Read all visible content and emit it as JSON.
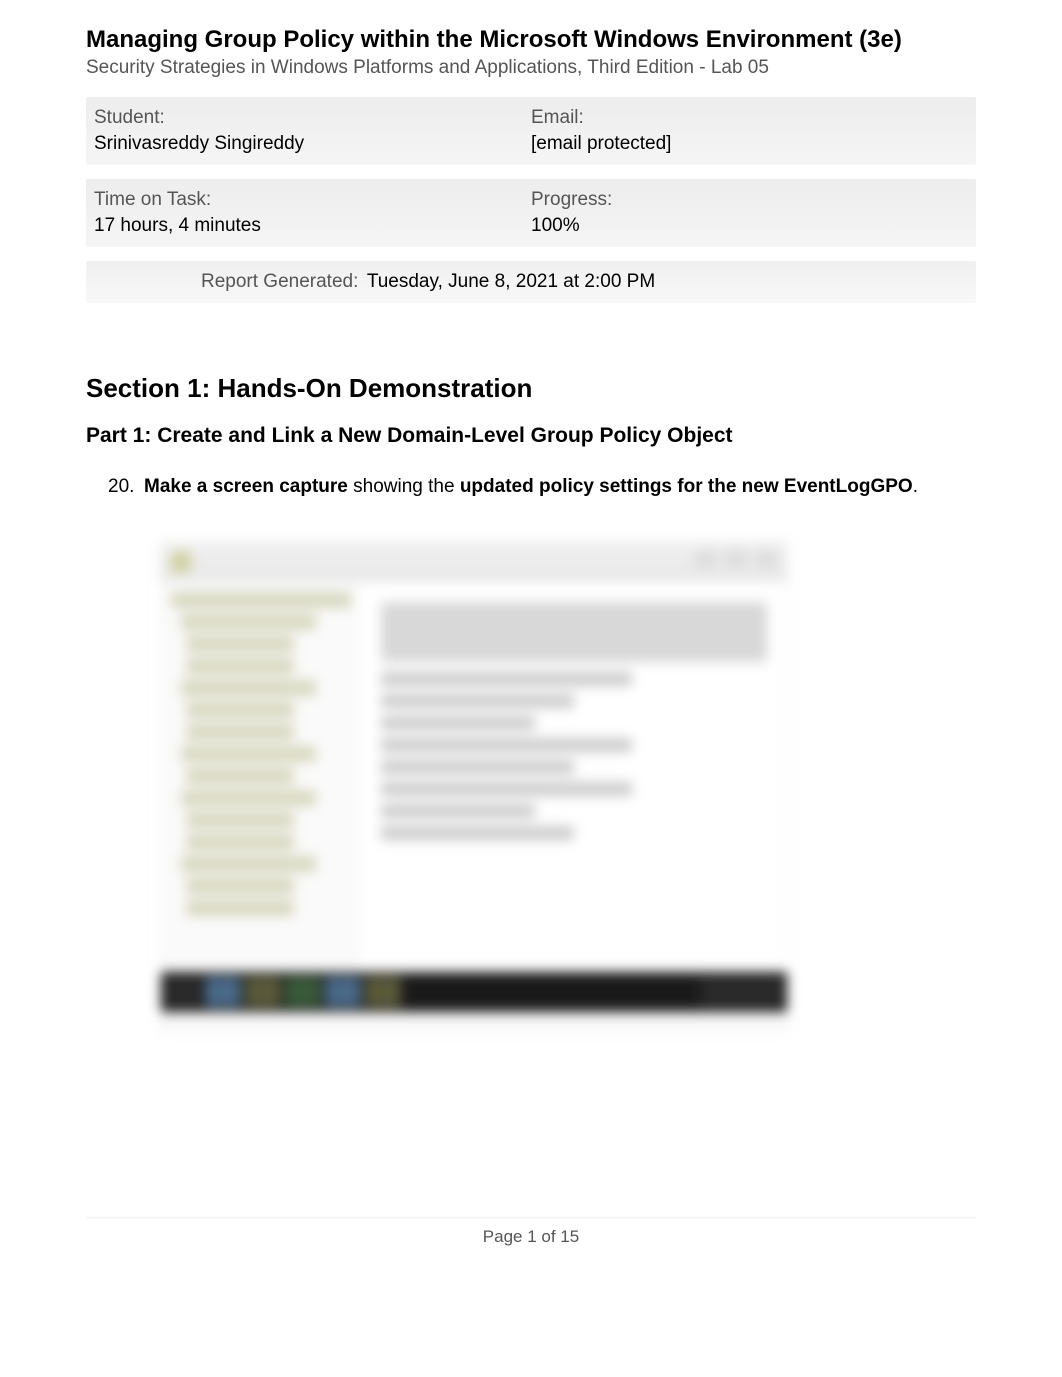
{
  "header": {
    "title": "Managing Group Policy within the Microsoft Windows Environment (3e)",
    "subtitle": "Security Strategies in Windows Platforms and Applications, Third Edition - Lab 05"
  },
  "student_info": {
    "student_label": "Student:",
    "student_value": "Srinivasreddy Singireddy",
    "email_label": "Email:",
    "email_value": "[email protected]"
  },
  "task_info": {
    "time_label": "Time on Task:",
    "time_value": "17 hours, 4 minutes",
    "progress_label": "Progress:",
    "progress_value": "100%"
  },
  "report": {
    "generated_label": "Report Generated:",
    "generated_value": "Tuesday, June 8, 2021 at 2:00 PM"
  },
  "section": {
    "heading": "Section 1: Hands-On Demonstration",
    "part_heading": "Part 1: Create and Link a New Domain-Level Group Policy Object"
  },
  "task": {
    "number": "20.",
    "text_bold1": "Make a screen capture",
    "text_mid": " showing the ",
    "text_bold2": "updated policy settings for the new EventLogGPO",
    "text_end": "."
  },
  "footer": {
    "page_text": "Page 1 of 15"
  }
}
